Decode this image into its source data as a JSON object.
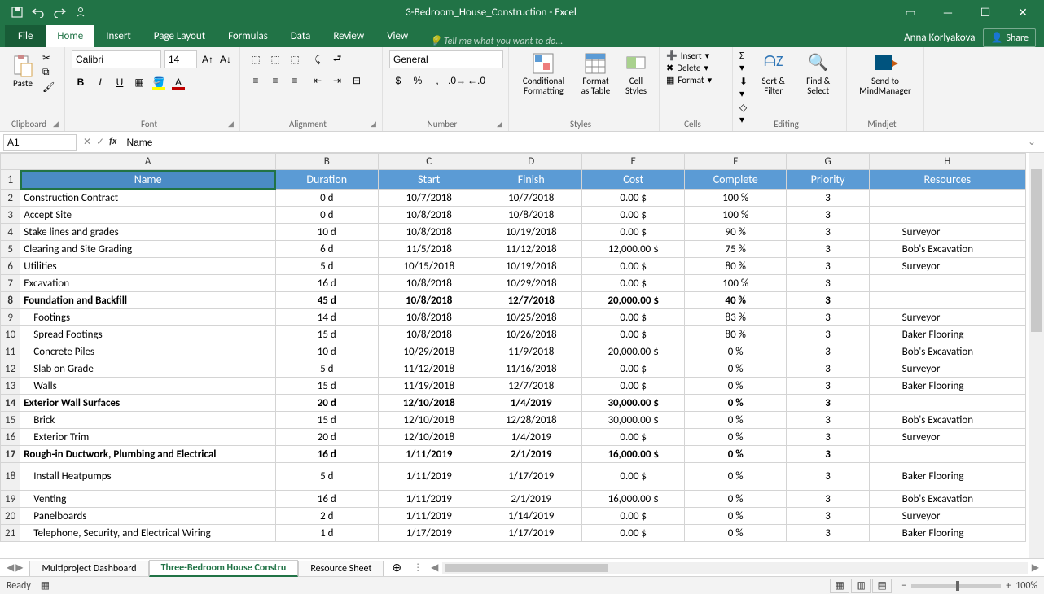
{
  "title": "3-Bedroom_House_Construction - Excel",
  "user": "Anna Korlyakova",
  "share_label": "Share",
  "tellme_placeholder": "Tell me what you want to do...",
  "menutabs": [
    "File",
    "Home",
    "Insert",
    "Page Layout",
    "Formulas",
    "Data",
    "Review",
    "View"
  ],
  "ribbon": {
    "clipboard": {
      "paste": "Paste",
      "label": "Clipboard"
    },
    "font": {
      "name": "Calibri",
      "size": "14",
      "label": "Font"
    },
    "alignment": {
      "label": "Alignment"
    },
    "number": {
      "format": "General",
      "label": "Number"
    },
    "styles": {
      "cond": "Conditional Formatting",
      "table": "Format as Table",
      "cell": "Cell Styles",
      "label": "Styles"
    },
    "cells": {
      "insert": "Insert",
      "delete": "Delete",
      "format": "Format",
      "label": "Cells"
    },
    "editing": {
      "sort": "Sort & Filter",
      "find": "Find & Select",
      "label": "Editing"
    },
    "mindjet": {
      "send": "Send to MindManager",
      "label": "Mindjet"
    }
  },
  "formula": {
    "namebox": "A1",
    "value": "Name"
  },
  "columns": [
    "A",
    "B",
    "C",
    "D",
    "E",
    "F",
    "G",
    "H"
  ],
  "headers": [
    "Name",
    "Duration",
    "Start",
    "Finish",
    "Cost",
    "Complete",
    "Priority",
    "Resources"
  ],
  "rows": [
    {
      "n": 2,
      "name": "Construction Contract",
      "dur": "0 d",
      "start": "10/7/2018",
      "finish": "10/7/2018",
      "cost": "0.00 $",
      "comp": "100 %",
      "pri": "3",
      "res": ""
    },
    {
      "n": 3,
      "name": "Accept Site",
      "dur": "0 d",
      "start": "10/8/2018",
      "finish": "10/8/2018",
      "cost": "0.00 $",
      "comp": "100 %",
      "pri": "3",
      "res": ""
    },
    {
      "n": 4,
      "name": "Stake lines and grades",
      "dur": "10 d",
      "start": "10/8/2018",
      "finish": "10/19/2018",
      "cost": "0.00 $",
      "comp": "90 %",
      "pri": "3",
      "res": "Surveyor"
    },
    {
      "n": 5,
      "name": "Clearing and Site Grading",
      "dur": "6 d",
      "start": "11/5/2018",
      "finish": "11/12/2018",
      "cost": "12,000.00 $",
      "comp": "75 %",
      "pri": "3",
      "res": "Bob's Excavation"
    },
    {
      "n": 6,
      "name": "Utilities",
      "dur": "5 d",
      "start": "10/15/2018",
      "finish": "10/19/2018",
      "cost": "0.00 $",
      "comp": "80 %",
      "pri": "3",
      "res": "Surveyor"
    },
    {
      "n": 7,
      "name": "Excavation",
      "dur": "16 d",
      "start": "10/8/2018",
      "finish": "10/29/2018",
      "cost": "0.00 $",
      "comp": "100 %",
      "pri": "3",
      "res": ""
    },
    {
      "n": 8,
      "bold": true,
      "name": "Foundation and Backfill",
      "dur": "45 d",
      "start": "10/8/2018",
      "finish": "12/7/2018",
      "cost": "20,000.00 $",
      "comp": "40 %",
      "pri": "3",
      "res": ""
    },
    {
      "n": 9,
      "indent": 1,
      "name": "Footings",
      "dur": "14 d",
      "start": "10/8/2018",
      "finish": "10/25/2018",
      "cost": "0.00 $",
      "comp": "83 %",
      "pri": "3",
      "res": "Surveyor"
    },
    {
      "n": 10,
      "indent": 1,
      "name": "Spread Footings",
      "dur": "15 d",
      "start": "10/8/2018",
      "finish": "10/26/2018",
      "cost": "0.00 $",
      "comp": "80 %",
      "pri": "3",
      "res": "Baker Flooring"
    },
    {
      "n": 11,
      "indent": 1,
      "name": "Concrete Piles",
      "dur": "10 d",
      "start": "10/29/2018",
      "finish": "11/9/2018",
      "cost": "20,000.00 $",
      "comp": "0 %",
      "pri": "3",
      "res": "Bob's Excavation"
    },
    {
      "n": 12,
      "indent": 1,
      "name": "Slab on Grade",
      "dur": "5 d",
      "start": "11/12/2018",
      "finish": "11/16/2018",
      "cost": "0.00 $",
      "comp": "0 %",
      "pri": "3",
      "res": "Surveyor"
    },
    {
      "n": 13,
      "indent": 1,
      "name": "Walls",
      "dur": "15 d",
      "start": "11/19/2018",
      "finish": "12/7/2018",
      "cost": "0.00 $",
      "comp": "0 %",
      "pri": "3",
      "res": "Baker Flooring"
    },
    {
      "n": 14,
      "bold": true,
      "name": "Exterior Wall Surfaces",
      "dur": "20 d",
      "start": "12/10/2018",
      "finish": "1/4/2019",
      "cost": "30,000.00 $",
      "comp": "0 %",
      "pri": "3",
      "res": ""
    },
    {
      "n": 15,
      "indent": 1,
      "name": "Brick",
      "dur": "15 d",
      "start": "12/10/2018",
      "finish": "12/28/2018",
      "cost": "30,000.00 $",
      "comp": "0 %",
      "pri": "3",
      "res": "Bob's Excavation"
    },
    {
      "n": 16,
      "indent": 1,
      "name": "Exterior Trim",
      "dur": "20 d",
      "start": "12/10/2018",
      "finish": "1/4/2019",
      "cost": "0.00 $",
      "comp": "0 %",
      "pri": "3",
      "res": "Surveyor"
    },
    {
      "n": 17,
      "bold": true,
      "name": "Rough-in Ductwork, Plumbing and Electrical",
      "dur": "16 d",
      "start": "1/11/2019",
      "finish": "2/1/2019",
      "cost": "16,000.00 $",
      "comp": "0 %",
      "pri": "3",
      "res": ""
    },
    {
      "n": 18,
      "indent": 1,
      "tall": true,
      "name": "Install Heatpumps",
      "dur": "5 d",
      "start": "1/11/2019",
      "finish": "1/17/2019",
      "cost": "0.00 $",
      "comp": "0 %",
      "pri": "3",
      "res": "Baker Flooring"
    },
    {
      "n": 19,
      "indent": 1,
      "name": "Venting",
      "dur": "16 d",
      "start": "1/11/2019",
      "finish": "2/1/2019",
      "cost": "16,000.00 $",
      "comp": "0 %",
      "pri": "3",
      "res": "Bob's Excavation"
    },
    {
      "n": 20,
      "indent": 1,
      "name": "Panelboards",
      "dur": "2 d",
      "start": "1/11/2019",
      "finish": "1/14/2019",
      "cost": "0.00 $",
      "comp": "0 %",
      "pri": "3",
      "res": "Surveyor"
    },
    {
      "n": 21,
      "indent": 1,
      "name": "Telephone, Security, and Electrical Wiring",
      "dur": "1 d",
      "start": "1/17/2019",
      "finish": "1/17/2019",
      "cost": "0.00 $",
      "comp": "0 %",
      "pri": "3",
      "res": "Baker Flooring"
    }
  ],
  "sheettabs": [
    "Multiproject Dashboard",
    "Three-Bedroom House Constru",
    "Resource Sheet"
  ],
  "active_sheet_index": 1,
  "status": {
    "ready": "Ready",
    "zoom": "100%"
  }
}
